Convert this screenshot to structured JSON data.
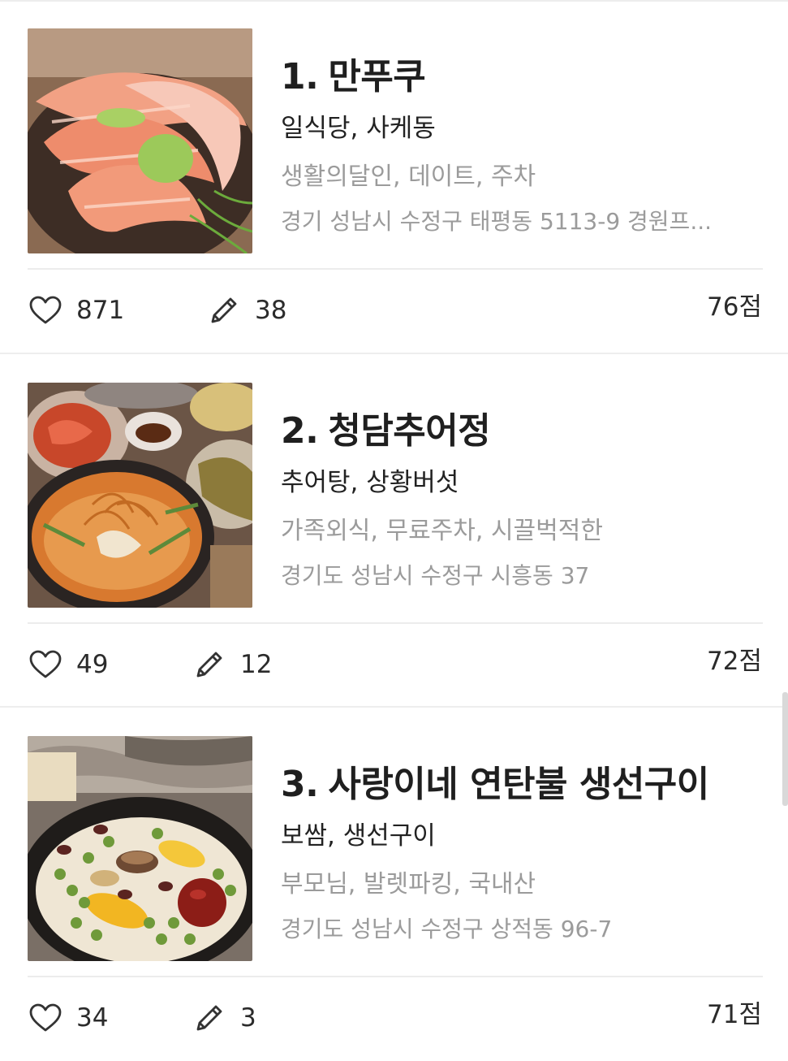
{
  "restaurants": [
    {
      "rank": "1.",
      "name": "만푸쿠",
      "categories": "일식당, 사케동",
      "tags": "생활의달인, 데이트, 주차",
      "address": "경기 성남시 수정구 태평동 5113-9 경원프...",
      "likes": "871",
      "reviews": "38",
      "score": "76점",
      "image": "salmon-rice-bowl"
    },
    {
      "rank": "2.",
      "name": "청담추어정",
      "categories": "추어탕, 상황버섯",
      "tags": "가족외식, 무료주차, 시끌벅적한",
      "address": "경기도 성남시 수정구 시흥동 37",
      "likes": "49",
      "reviews": "12",
      "score": "72점",
      "image": "loach-soup-table"
    },
    {
      "rank": "3.",
      "name": "사랑이네 연탄불 생선구이",
      "categories": "보쌈, 생선구이",
      "tags": "부모님, 발렛파킹, 국내산",
      "address": "경기도 성남시 수정구 상적동 96-7",
      "likes": "34",
      "reviews": "3",
      "score": "71점",
      "image": "stone-pot-rice"
    }
  ],
  "icons": {
    "like": "heart-outline-icon",
    "review": "pencil-icon"
  },
  "colors": {
    "title": "#1f1f1f",
    "subtext": "#9b9b9b",
    "divider": "#eeeeee"
  }
}
